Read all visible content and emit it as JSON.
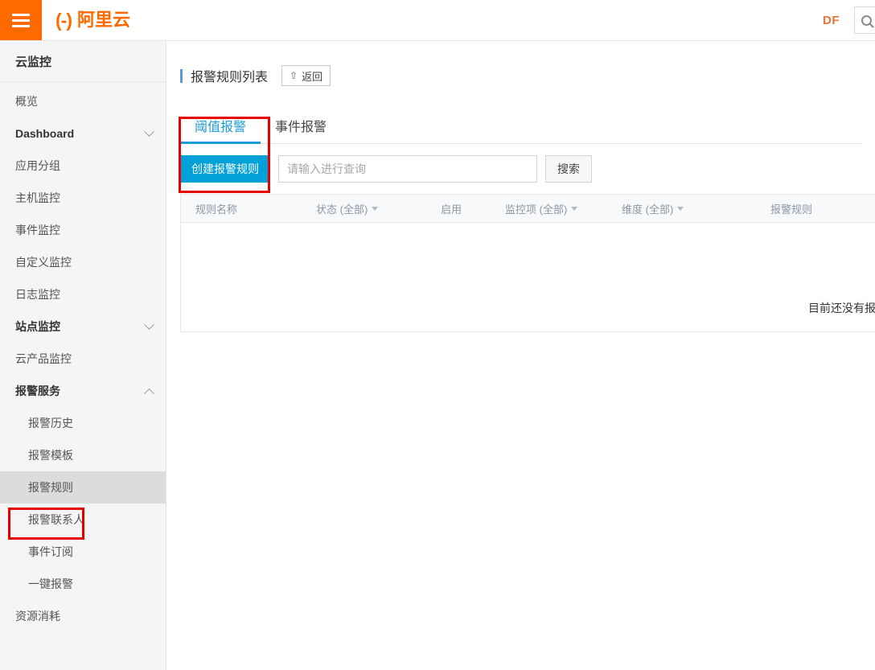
{
  "header": {
    "menu_icon": "hamburger-icon",
    "logo_mark": "(-)",
    "logo_text": "阿里云",
    "user_initials": "DF",
    "search_icon": "search-icon"
  },
  "sidebar": {
    "product_title": "云监控",
    "items": [
      {
        "label": "概览",
        "bold": false,
        "sub": false,
        "chevron": "",
        "active": false
      },
      {
        "label": "Dashboard",
        "bold": true,
        "sub": false,
        "chevron": "down",
        "active": false
      },
      {
        "label": "应用分组",
        "bold": false,
        "sub": false,
        "chevron": "",
        "active": false
      },
      {
        "label": "主机监控",
        "bold": false,
        "sub": false,
        "chevron": "",
        "active": false
      },
      {
        "label": "事件监控",
        "bold": false,
        "sub": false,
        "chevron": "",
        "active": false
      },
      {
        "label": "自定义监控",
        "bold": false,
        "sub": false,
        "chevron": "",
        "active": false
      },
      {
        "label": "日志监控",
        "bold": false,
        "sub": false,
        "chevron": "",
        "active": false
      },
      {
        "label": "站点监控",
        "bold": true,
        "sub": false,
        "chevron": "down",
        "active": false
      },
      {
        "label": "云产品监控",
        "bold": false,
        "sub": false,
        "chevron": "",
        "active": false
      },
      {
        "label": "报警服务",
        "bold": true,
        "sub": false,
        "chevron": "up",
        "active": false
      },
      {
        "label": "报警历史",
        "bold": false,
        "sub": true,
        "chevron": "",
        "active": false
      },
      {
        "label": "报警模板",
        "bold": false,
        "sub": true,
        "chevron": "",
        "active": false
      },
      {
        "label": "报警规则",
        "bold": false,
        "sub": true,
        "chevron": "",
        "active": true
      },
      {
        "label": "报警联系人",
        "bold": false,
        "sub": true,
        "chevron": "",
        "active": false
      },
      {
        "label": "事件订阅",
        "bold": false,
        "sub": true,
        "chevron": "",
        "active": false
      },
      {
        "label": "一键报警",
        "bold": false,
        "sub": true,
        "chevron": "",
        "active": false
      },
      {
        "label": "资源消耗",
        "bold": false,
        "sub": false,
        "chevron": "",
        "active": false
      }
    ],
    "collapse_icon": "chevron-left-icon"
  },
  "main": {
    "page_title": "报警规则列表",
    "back_button": {
      "label": "返回",
      "icon": "upload-arrow-icon"
    },
    "tabs": [
      {
        "label": "阈值报警",
        "active": true
      },
      {
        "label": "事件报警",
        "active": false
      }
    ],
    "toolbar": {
      "create_button": "创建报警规则",
      "search_placeholder": "请输入进行查询",
      "search_value": "",
      "search_button": "搜索"
    },
    "table": {
      "columns": [
        {
          "label": "规则名称",
          "caret": false
        },
        {
          "label": "状态 (全部)",
          "caret": true
        },
        {
          "label": "启用",
          "caret": false
        },
        {
          "label": "监控项 (全部)",
          "caret": true
        },
        {
          "label": "维度 (全部)",
          "caret": true
        },
        {
          "label": "报警规则",
          "caret": false
        }
      ],
      "rows": [],
      "empty_text": "目前还没有报警规则"
    }
  },
  "annotations": {
    "sidebar_highlight": "报警规则",
    "create_highlight": "创建报警规则",
    "color": "#e60000"
  }
}
